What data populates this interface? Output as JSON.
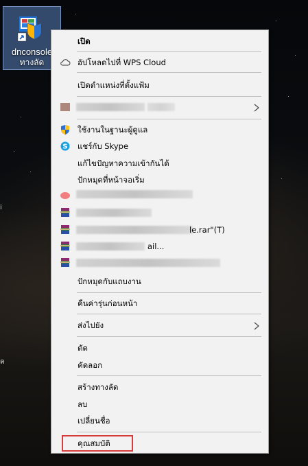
{
  "desktop": {
    "shortcut": {
      "label_line1": "dnconsole",
      "label_line2": "ทางลัด",
      "icon": "app-shortcut-icon"
    }
  },
  "context_menu": {
    "items": {
      "open": "เปิด",
      "upload_wps": "อัปโหลดไปที่ WPS Cloud",
      "open_file_location": "เปิดตำแหน่งที่ตั้งแฟ้ม",
      "run_as_admin": "ใช้งานในฐานะผู้ดูแล",
      "share_skype": "แชร์กับ Skype",
      "troubleshoot": "แก้ไขปัญหาความเข้ากันได้",
      "pin_start": "ปักหมุดที่หน้าจอเริ่ม",
      "rar_item_text": "le.rar\"(T)",
      "rar_item2_text": "ail...",
      "pin_taskbar": "ปักหมุดกับแถบงาน",
      "restore_versions": "คืนค่ารุ่นก่อนหน้า",
      "send_to": "ส่งไปยัง",
      "cut": "ตัด",
      "copy": "คัดลอก",
      "create_shortcut": "สร้างทางลัด",
      "delete": "ลบ",
      "rename": "เปลี่ยนชื่อ",
      "properties": "คุณสมบัติ"
    },
    "highlight_color": "#d83b3b"
  }
}
